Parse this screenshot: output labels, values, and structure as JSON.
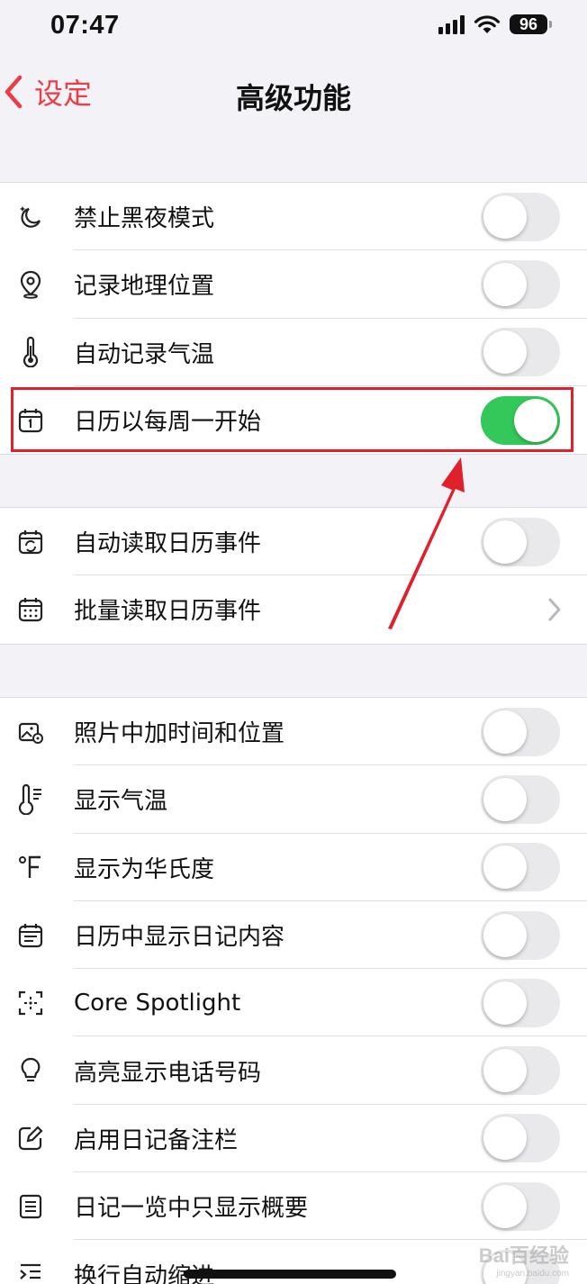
{
  "status_bar": {
    "time": "07:47",
    "battery": "96"
  },
  "nav": {
    "back_label": "设定",
    "title": "高级功能"
  },
  "groups": [
    {
      "rows": [
        {
          "icon": "moon-stars-icon",
          "label": "禁止黑夜模式",
          "control": "toggle",
          "on": false
        },
        {
          "icon": "map-pin-icon",
          "label": "记录地理位置",
          "control": "toggle",
          "on": false
        },
        {
          "icon": "thermometer-icon",
          "label": "自动记录气温",
          "control": "toggle",
          "on": false
        },
        {
          "icon": "calendar-one-icon",
          "label": "日历以每周一开始",
          "control": "toggle",
          "on": true
        }
      ]
    },
    {
      "rows": [
        {
          "icon": "calendar-sync-icon",
          "label": "自动读取日历事件",
          "control": "toggle",
          "on": false
        },
        {
          "icon": "calendar-grid-icon",
          "label": "批量读取日历事件",
          "control": "chevron"
        }
      ]
    },
    {
      "rows": [
        {
          "icon": "photo-location-icon",
          "label": "照片中加时间和位置",
          "control": "toggle",
          "on": false
        },
        {
          "icon": "thermometer-lines-icon",
          "label": "显示气温",
          "control": "toggle",
          "on": false
        },
        {
          "icon": "fahrenheit-icon",
          "label": "显示为华氏度",
          "control": "toggle",
          "on": false
        },
        {
          "icon": "calendar-lines-icon",
          "label": "日历中显示日记内容",
          "control": "toggle",
          "on": false
        },
        {
          "icon": "spotlight-scan-icon",
          "label": "Core Spotlight",
          "control": "toggle",
          "on": false
        },
        {
          "icon": "lightbulb-icon",
          "label": "高亮显示电话号码",
          "control": "toggle",
          "on": false
        },
        {
          "icon": "note-edit-icon",
          "label": "启用日记备注栏",
          "control": "toggle",
          "on": false
        },
        {
          "icon": "list-doc-icon",
          "label": "日记一览中只显示概要",
          "control": "toggle",
          "on": false
        },
        {
          "icon": "indent-icon",
          "label": "换行自动缩进",
          "control": "toggle",
          "on": false
        }
      ]
    }
  ],
  "colors": {
    "accent": "#ec3c44",
    "toggle_on": "#34c759",
    "annotation": "#e0202a"
  },
  "watermark": {
    "main": "Bai百经验",
    "sub": "jingyan.baidu.com"
  }
}
